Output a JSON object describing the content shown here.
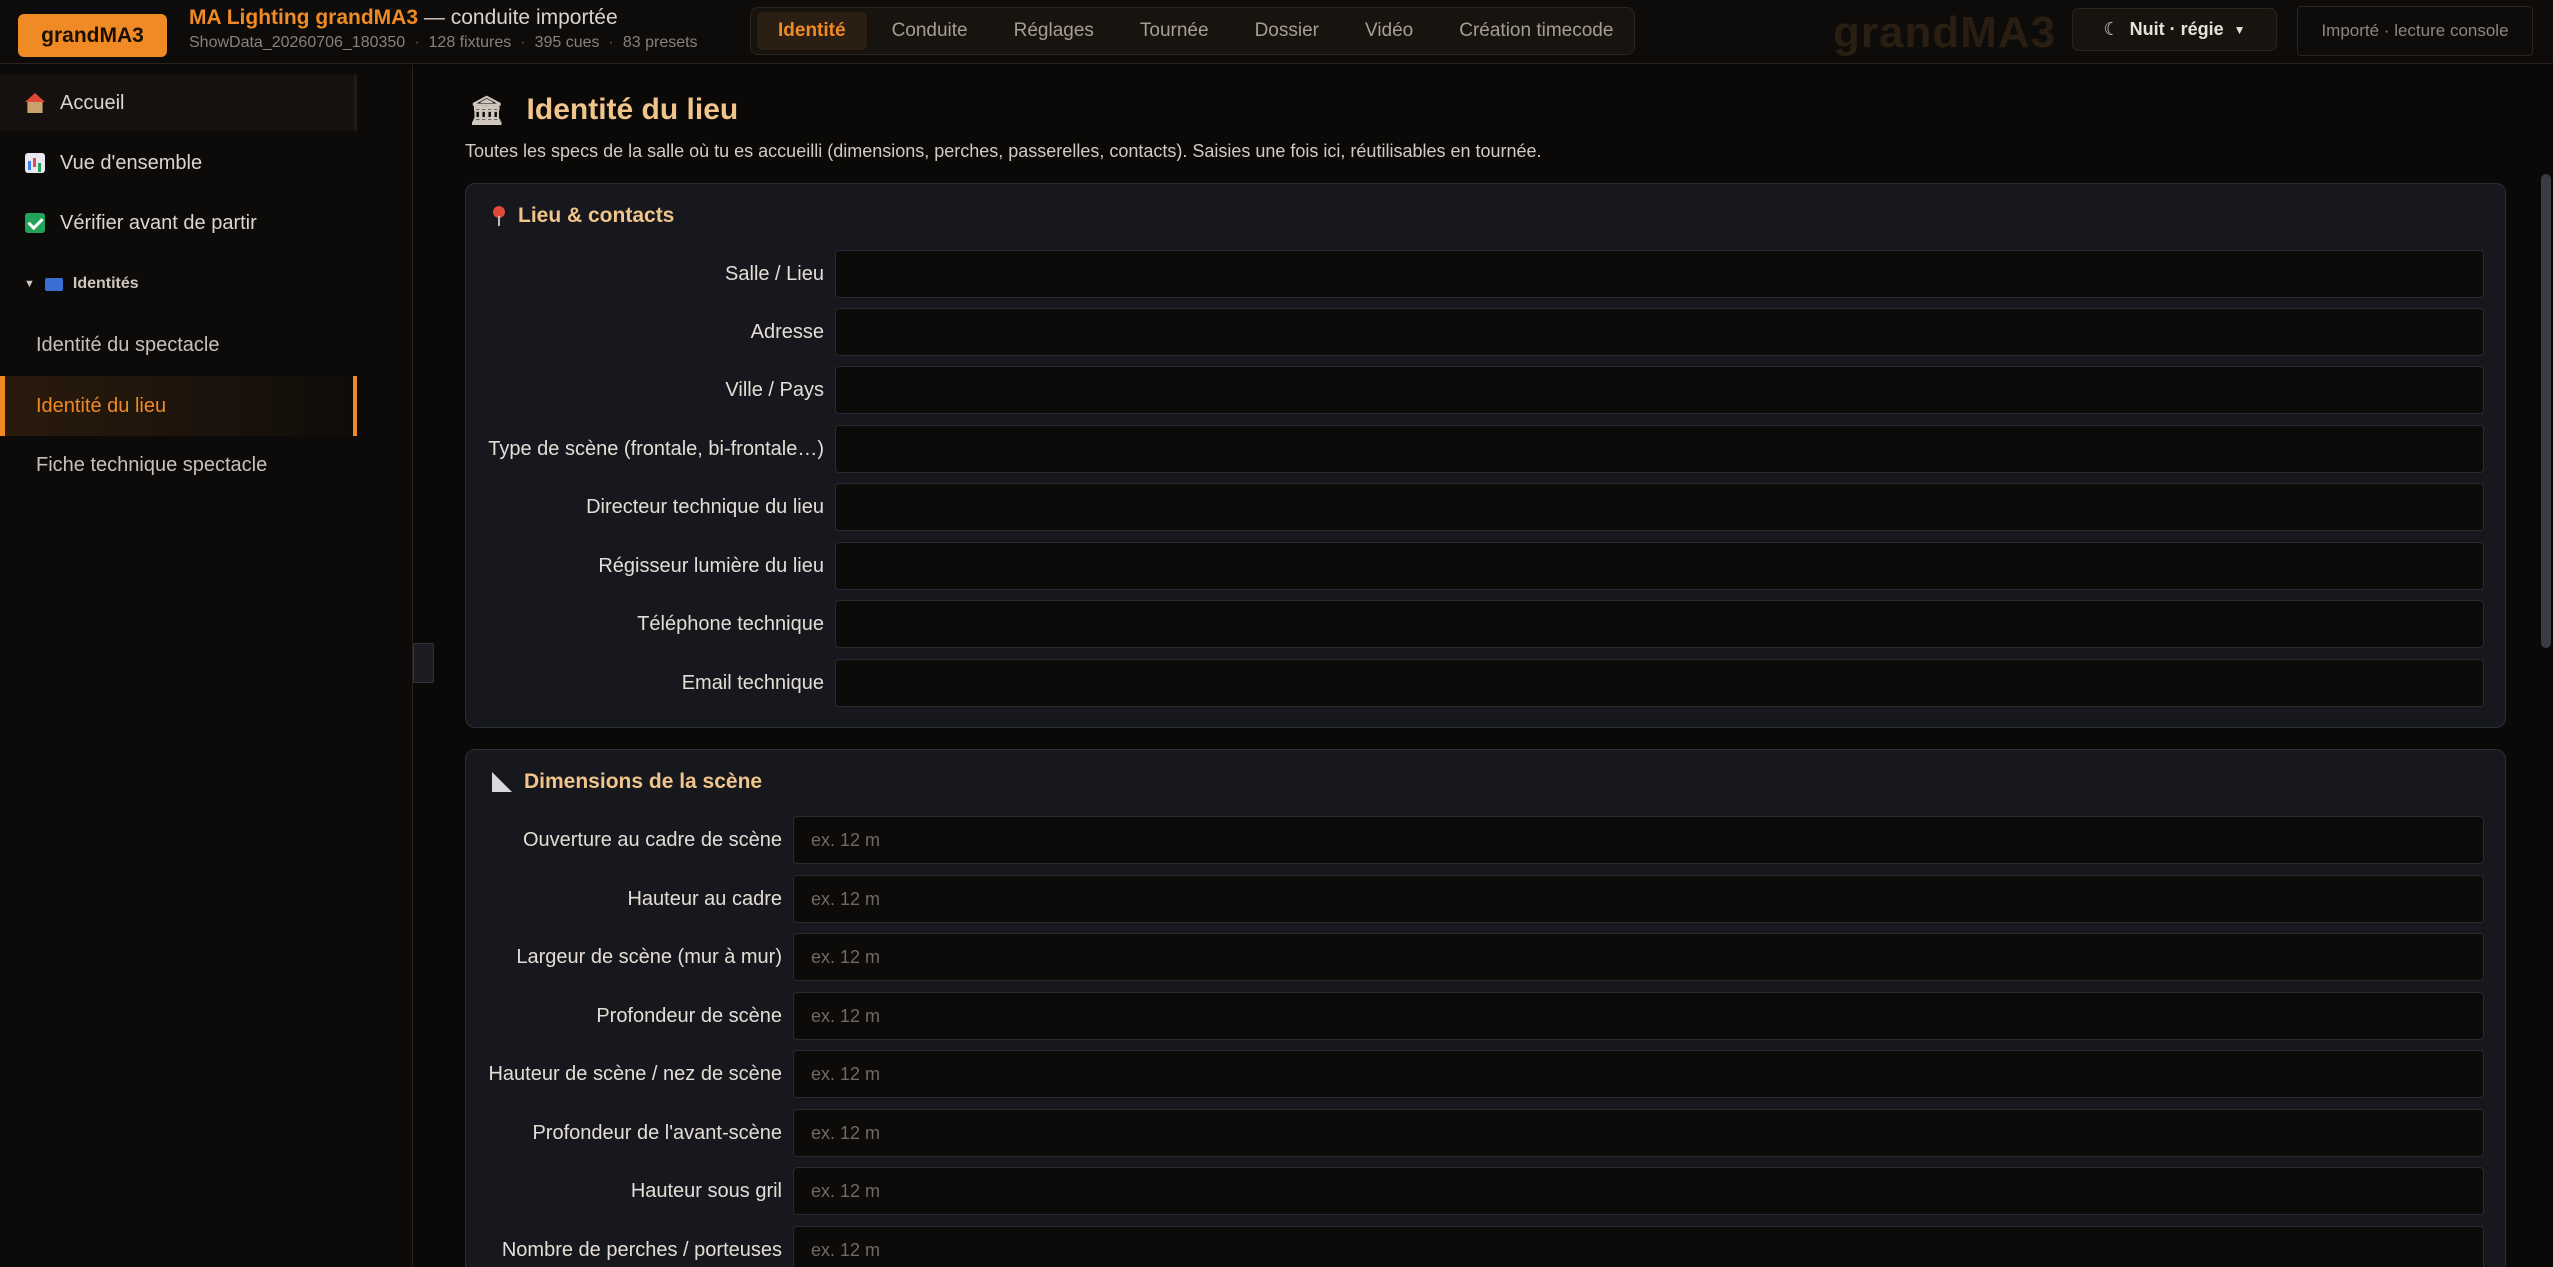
{
  "topbar": {
    "brand_button": "grandMA3",
    "app_title_main": "MA Lighting grandMA3",
    "app_title_suffix": "— conduite importée",
    "meta": {
      "file": "ShowData_20260706_180350",
      "fixtures": "128 fixtures",
      "cues": "395 cues",
      "presets": "83 presets"
    },
    "tabs": [
      {
        "label": "Identité",
        "active": true
      },
      {
        "label": "Conduite"
      },
      {
        "label": "Réglages"
      },
      {
        "label": "Tournée"
      },
      {
        "label": "Dossier"
      },
      {
        "label": "Vidéo"
      },
      {
        "label": "Création timecode"
      }
    ],
    "watermark": "grandMA3",
    "theme_button": "Nuit · régie",
    "theme_icon": "moon-icon",
    "import_status": "Importé · lecture console"
  },
  "sidebar": {
    "items": [
      {
        "label": "Accueil",
        "icon": "home-icon"
      },
      {
        "label": "Vue d'ensemble",
        "icon": "chart-icon"
      },
      {
        "label": "Vérifier avant de partir",
        "icon": "check-icon"
      }
    ],
    "group": {
      "label": "Identités",
      "icon": "id-card-icon"
    },
    "sub_items": [
      {
        "label": "Identité du spectacle",
        "active": false
      },
      {
        "label": "Identité du lieu",
        "active": true
      },
      {
        "label": "Fiche technique spectacle",
        "active": false
      }
    ]
  },
  "main": {
    "page_icon": "bank-icon",
    "title": "Identité du lieu",
    "description": "Toutes les specs de la salle où tu es accueilli (dimensions, perches, passerelles, contacts). Saisies une fois ici, réutilisables en tournée.",
    "sections": [
      {
        "title": "Lieu & contacts",
        "icon": "pin-icon",
        "fields": [
          {
            "label": "Salle / Lieu",
            "value": "",
            "placeholder": ""
          },
          {
            "label": "Adresse",
            "value": "",
            "placeholder": ""
          },
          {
            "label": "Ville / Pays",
            "value": "",
            "placeholder": ""
          },
          {
            "label": "Type de scène (frontale, bi-frontale…)",
            "value": "",
            "placeholder": ""
          },
          {
            "label": "Directeur technique du lieu",
            "value": "",
            "placeholder": ""
          },
          {
            "label": "Régisseur lumière du lieu",
            "value": "",
            "placeholder": ""
          },
          {
            "label": "Téléphone technique",
            "value": "",
            "placeholder": ""
          },
          {
            "label": "Email technique",
            "value": "",
            "placeholder": ""
          }
        ]
      },
      {
        "title": "Dimensions de la scène",
        "icon": "ruler-icon",
        "fields": [
          {
            "label": "Ouverture au cadre de scène",
            "value": "",
            "placeholder": "ex. 12 m"
          },
          {
            "label": "Hauteur au cadre",
            "value": "",
            "placeholder": "ex. 12 m"
          },
          {
            "label": "Largeur de scène (mur à mur)",
            "value": "",
            "placeholder": "ex. 12 m"
          },
          {
            "label": "Profondeur de scène",
            "value": "",
            "placeholder": "ex. 12 m"
          },
          {
            "label": "Hauteur de scène / nez de scène",
            "value": "",
            "placeholder": "ex. 12 m"
          },
          {
            "label": "Profondeur de l'avant-scène",
            "value": "",
            "placeholder": "ex. 12 m"
          },
          {
            "label": "Hauteur sous gril",
            "value": "",
            "placeholder": "ex. 12 m"
          },
          {
            "label": "Nombre de perches / porteuses",
            "value": "",
            "placeholder": "ex. 12 m"
          }
        ]
      }
    ]
  },
  "colors": {
    "accent": "#f08a24",
    "title": "#f0c48a",
    "background": "#0b0908",
    "card": "#17181d"
  }
}
